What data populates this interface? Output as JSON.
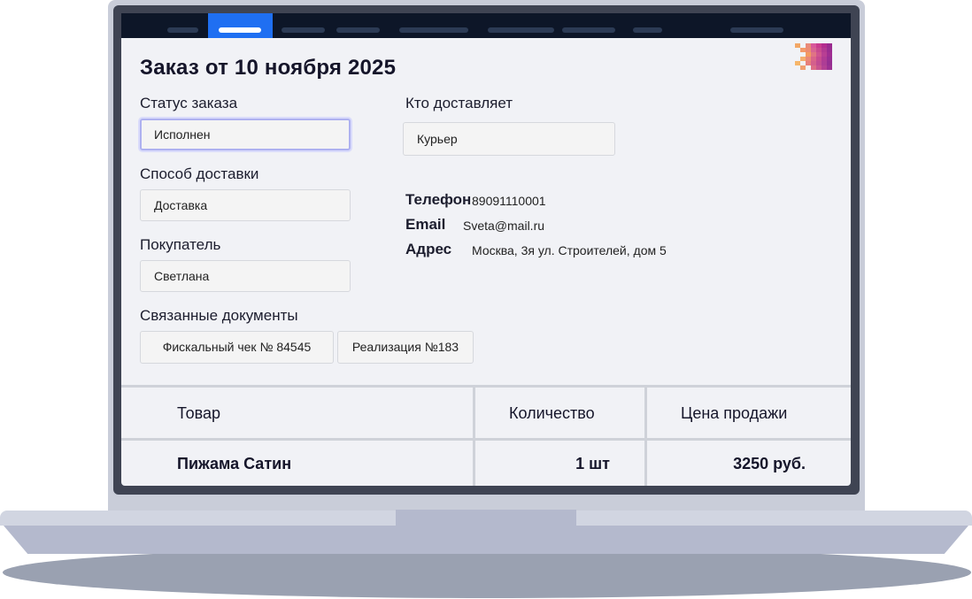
{
  "order": {
    "title": "Заказ от 10 ноября 2025",
    "status_label": "Статус заказа",
    "status_value": "Исполнен",
    "delivery_method_label": "Способ доставки",
    "delivery_method_value": "Доставка",
    "buyer_label": "Покупатель",
    "buyer_value": "Светлана",
    "courier_label": "Кто доставляет",
    "courier_value": "Курьер"
  },
  "contact": {
    "phone_label": "Телефон",
    "phone_value": "89091110001",
    "email_label": "Email",
    "email_value": "Sveta@mail.ru",
    "address_label": "Адрес",
    "address_value": "Москва, 3я ул. Строителей, дом 5"
  },
  "documents": {
    "label": "Связанные документы",
    "items": [
      "Фискальный чек № 84545",
      "Реализация №183"
    ]
  },
  "table": {
    "headers": [
      "Товар",
      "Количество",
      "Цена продажи"
    ],
    "rows": [
      [
        "Пижама Сатин",
        "1 шт",
        "3250 руб."
      ]
    ]
  },
  "colors": {
    "nav_background": "#0d1628",
    "nav_active": "#1f6ff2",
    "screen_background": "#f1f2f6"
  }
}
